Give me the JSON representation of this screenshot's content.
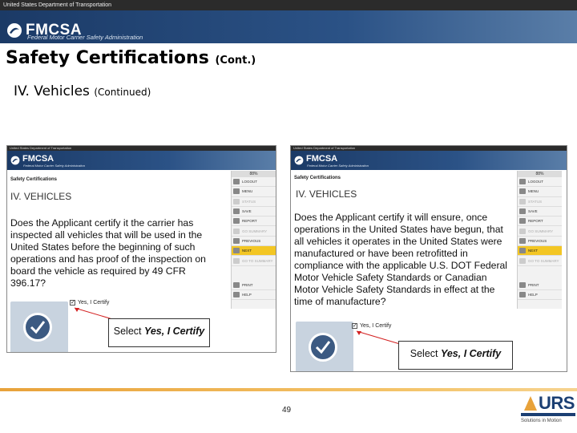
{
  "banner": {
    "agency": "United States Department of Transportation",
    "name": "FMCSA",
    "tagline": "Federal Motor Carrier Safety Administration"
  },
  "slide": {
    "title": "Safety Certifications",
    "title_suffix": "(Cont.)",
    "section": "IV.  Vehicles",
    "section_suffix": "(Continued)",
    "page_number": "49"
  },
  "screens": [
    {
      "agency": "United States Department of Transportation",
      "name": "FMCSA",
      "tagline": "Federal Motor Carrier Safety Administration",
      "heading": "Safety Certifications",
      "section": "IV. VEHICLES",
      "question": "Does the Applicant certify it the carrier has inspected all vehicles that will be used in the United States before the beginning of such operations and has proof of the inspection on board the vehicle as required by 49 CFR 396.17?",
      "progress": "88%",
      "menu": [
        "LOGOUT",
        "MENU",
        "STATUS",
        "SAVE",
        "REPORT",
        "GO SUMMARY",
        "PREVIOUS",
        "NEXT",
        "GO TO SUMMARY",
        "PRINT",
        "HELP"
      ],
      "certify_label": "Yes, I Certify",
      "callout_prefix": "Select ",
      "callout_emph": "Yes, I Certify"
    },
    {
      "agency": "United States Department of Transportation",
      "name": "FMCSA",
      "tagline": "Federal Motor Carrier Safety Administration",
      "heading": "Safety Certifications",
      "section": "IV. VEHICLES",
      "question": "Does the Applicant certify it will ensure, once operations in the United States have begun, that all vehicles it operates in the United States were manufactured or have been retrofitted in compliance with the applicable U.S. DOT Federal Motor Vehicle Safety Standards or Canadian Motor Vehicle Safety Standards in effect at the time of manufacture?",
      "progress": "88%",
      "menu": [
        "LOGOUT",
        "MENU",
        "STATUS",
        "SAVE",
        "REPORT",
        "GO SUMMARY",
        "PREVIOUS",
        "NEXT",
        "GO TO SUMMARY",
        "PRINT",
        "HELP"
      ],
      "certify_label": "Yes, I Certify",
      "callout_prefix": "Select ",
      "callout_emph": "Yes, I Certify"
    }
  ],
  "footer": {
    "logo_text": "URS",
    "logo_sub": "Solutions in Motion"
  },
  "colors": {
    "banner": "#2b5286",
    "menu_active": "#f3c624",
    "footer_rule": "#e8a23a",
    "urs_blue": "#1b3f73"
  }
}
